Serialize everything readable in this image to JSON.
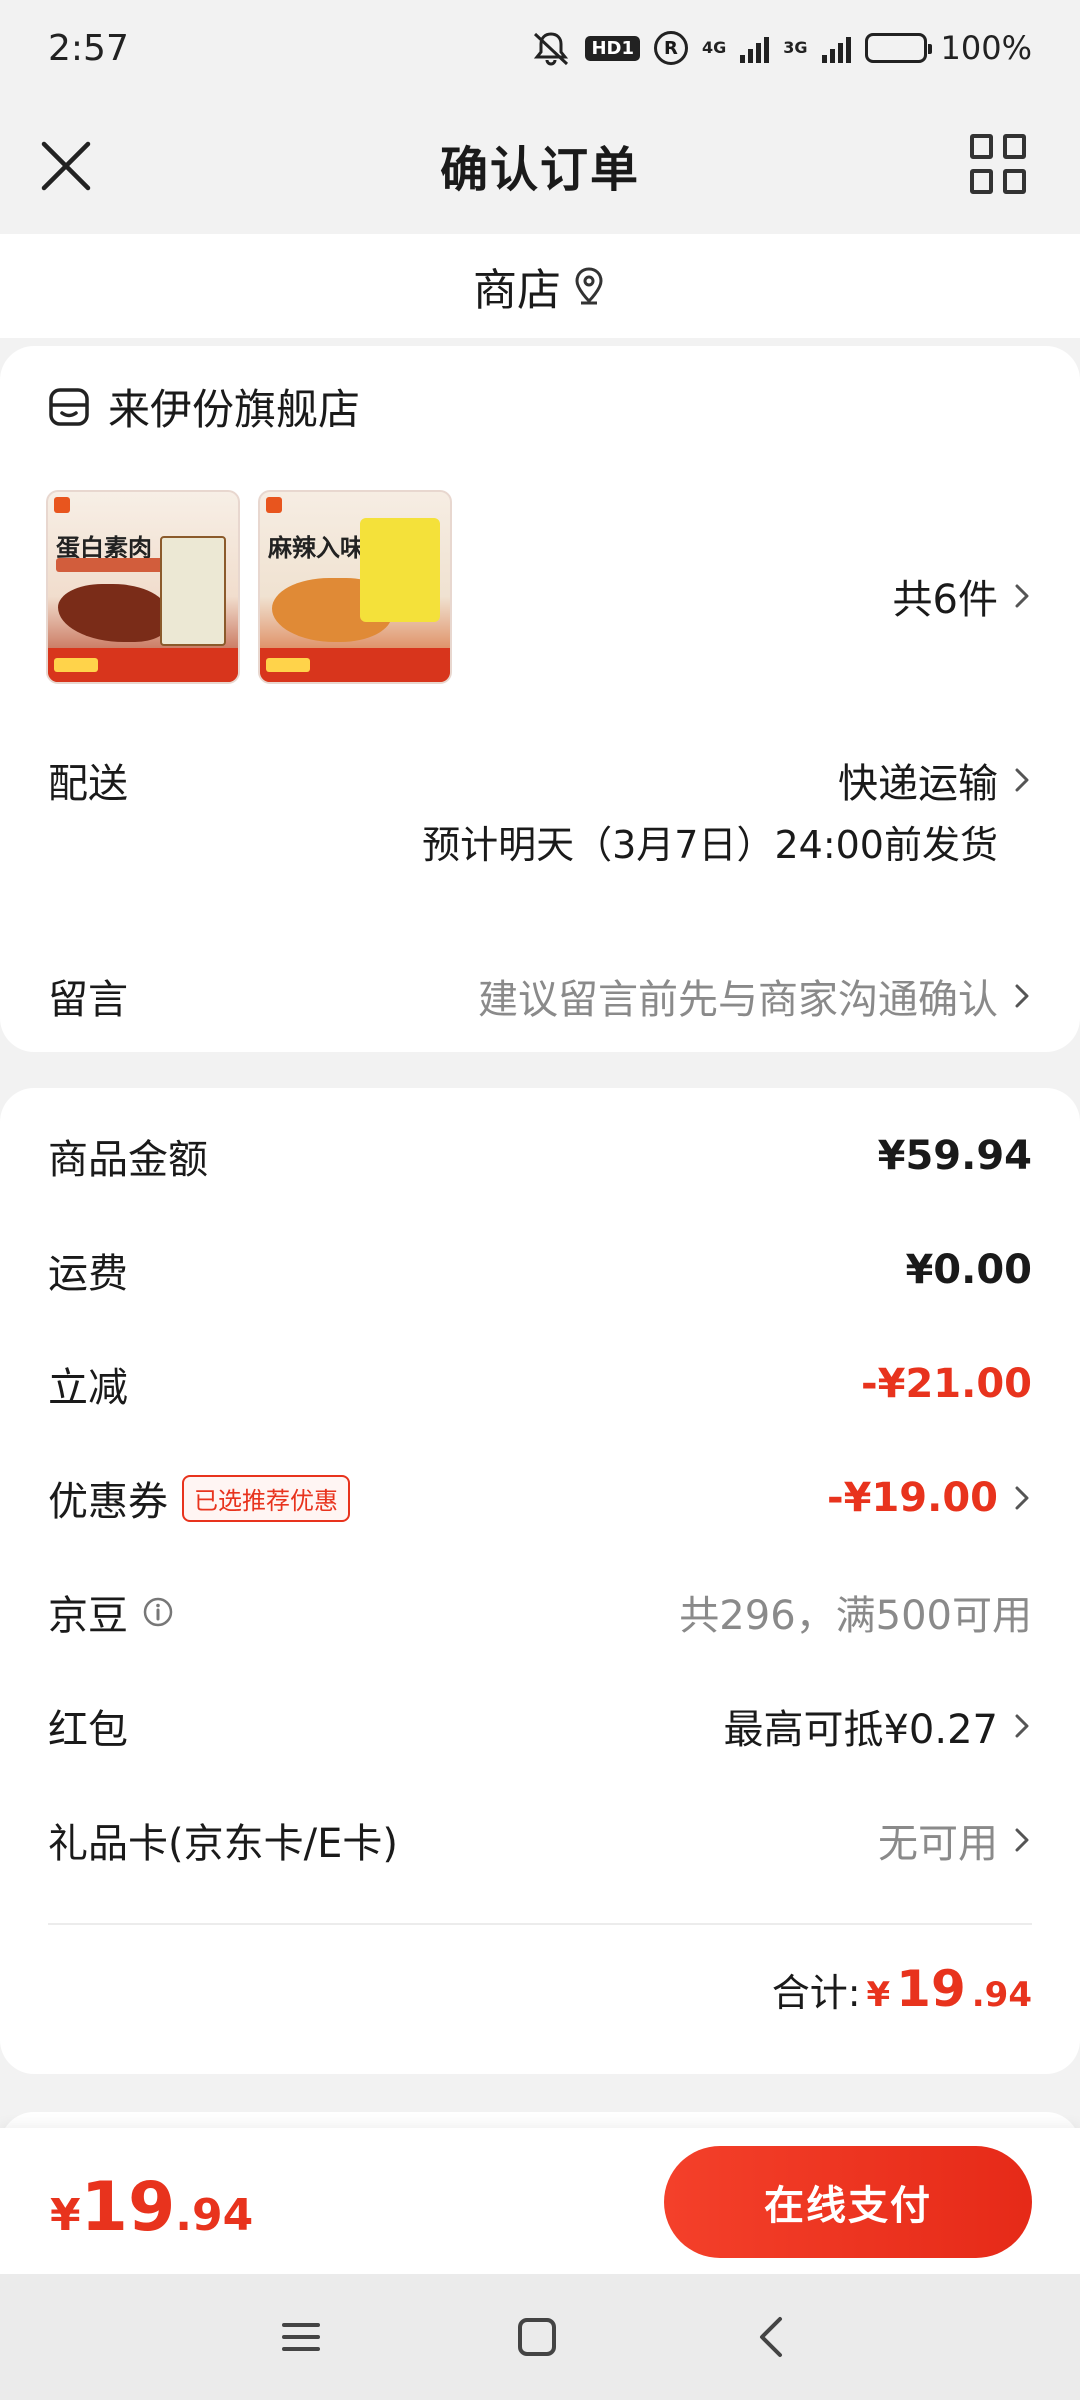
{
  "status_bar": {
    "time": "2:57",
    "hd": "HD1",
    "net1": "4G",
    "net2": "3G",
    "battery": "100%"
  },
  "nav": {
    "title": "确认订单"
  },
  "store_bar": {
    "label": "商店"
  },
  "order": {
    "shop_name": "来伊份旗舰店",
    "products": [
      {
        "title": "蛋白素肉"
      },
      {
        "title": "麻辣入味"
      }
    ],
    "items_count": "共6件",
    "delivery": {
      "label": "配送",
      "method": "快递运输",
      "estimate": "预计明天（3月7日）24:00前发货"
    },
    "note": {
      "label": "留言",
      "placeholder": "建议留言前先与商家沟通确认"
    }
  },
  "price": {
    "rows": [
      {
        "label": "商品金额",
        "value": "¥59.94"
      },
      {
        "label": "运费",
        "value": "¥0.00"
      },
      {
        "label": "立减",
        "value": "-¥21.00"
      },
      {
        "label": "优惠券",
        "tag": "已选推荐优惠",
        "value": "-¥19.00"
      },
      {
        "label": "京豆",
        "value": "共296，满500可用"
      },
      {
        "label": "红包",
        "value": "最高可抵¥0.27"
      },
      {
        "label": "礼品卡(京东卡/E卡)",
        "value": "无可用"
      }
    ],
    "total_label": "合计:",
    "total_symbol": "¥",
    "total_int": "19",
    "total_dec": ".94"
  },
  "pay_bar": {
    "symbol": "¥",
    "int": "19",
    "dec": ".94",
    "button": "在线支付"
  },
  "colors": {
    "accent": "#e8331d",
    "background": "#f2f2f2"
  }
}
